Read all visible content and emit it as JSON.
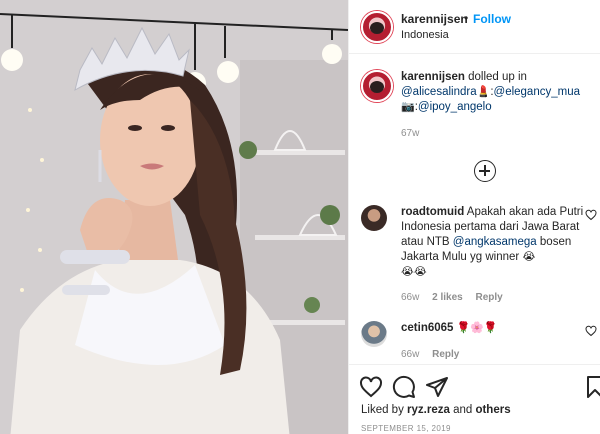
{
  "post": {
    "username": "karennijsen",
    "separator": "•",
    "follow_label": "Follow",
    "location": "Indonesia"
  },
  "caption": {
    "username": "karennijsen",
    "text_1": " dolled up in",
    "mention_1": "@alicesalindra",
    "emoji_1": "💄",
    "text_2": ":",
    "mention_2": "@elegancy_mua",
    "emoji_2": "📷",
    "text_3": ":",
    "mention_3": "@ipoy_angelo",
    "time": "67w"
  },
  "comments": [
    {
      "username": "roadtomuid",
      "text": " Apakah akan ada Putri Indonesia pertama dari Jawa Barat atau NTB ",
      "mention": "@angkasamega",
      "text_after": " bosen Jakarta Mulu yg winner ",
      "emoji": "😭",
      "emoji_line": "😭😭",
      "time": "66w",
      "likes": "2 likes",
      "reply": "Reply"
    },
    {
      "username": "cetin6065",
      "text": " 🌹🌸🌹",
      "time": "66w",
      "reply": "Reply"
    }
  ],
  "footer": {
    "liked_by_prefix": "Liked by ",
    "liked_by_user": "ryz.reza",
    "liked_by_and": " and ",
    "liked_by_others": "others",
    "date": "SEPTEMBER 15, 2019"
  },
  "icons": {
    "like": "heart-icon",
    "comment": "comment-icon",
    "share": "share-icon",
    "save": "bookmark-icon",
    "load_more": "plus-circle-icon"
  },
  "colors": {
    "link": "#0095f6",
    "mention": "#00376b",
    "muted": "#8e8e8e"
  }
}
